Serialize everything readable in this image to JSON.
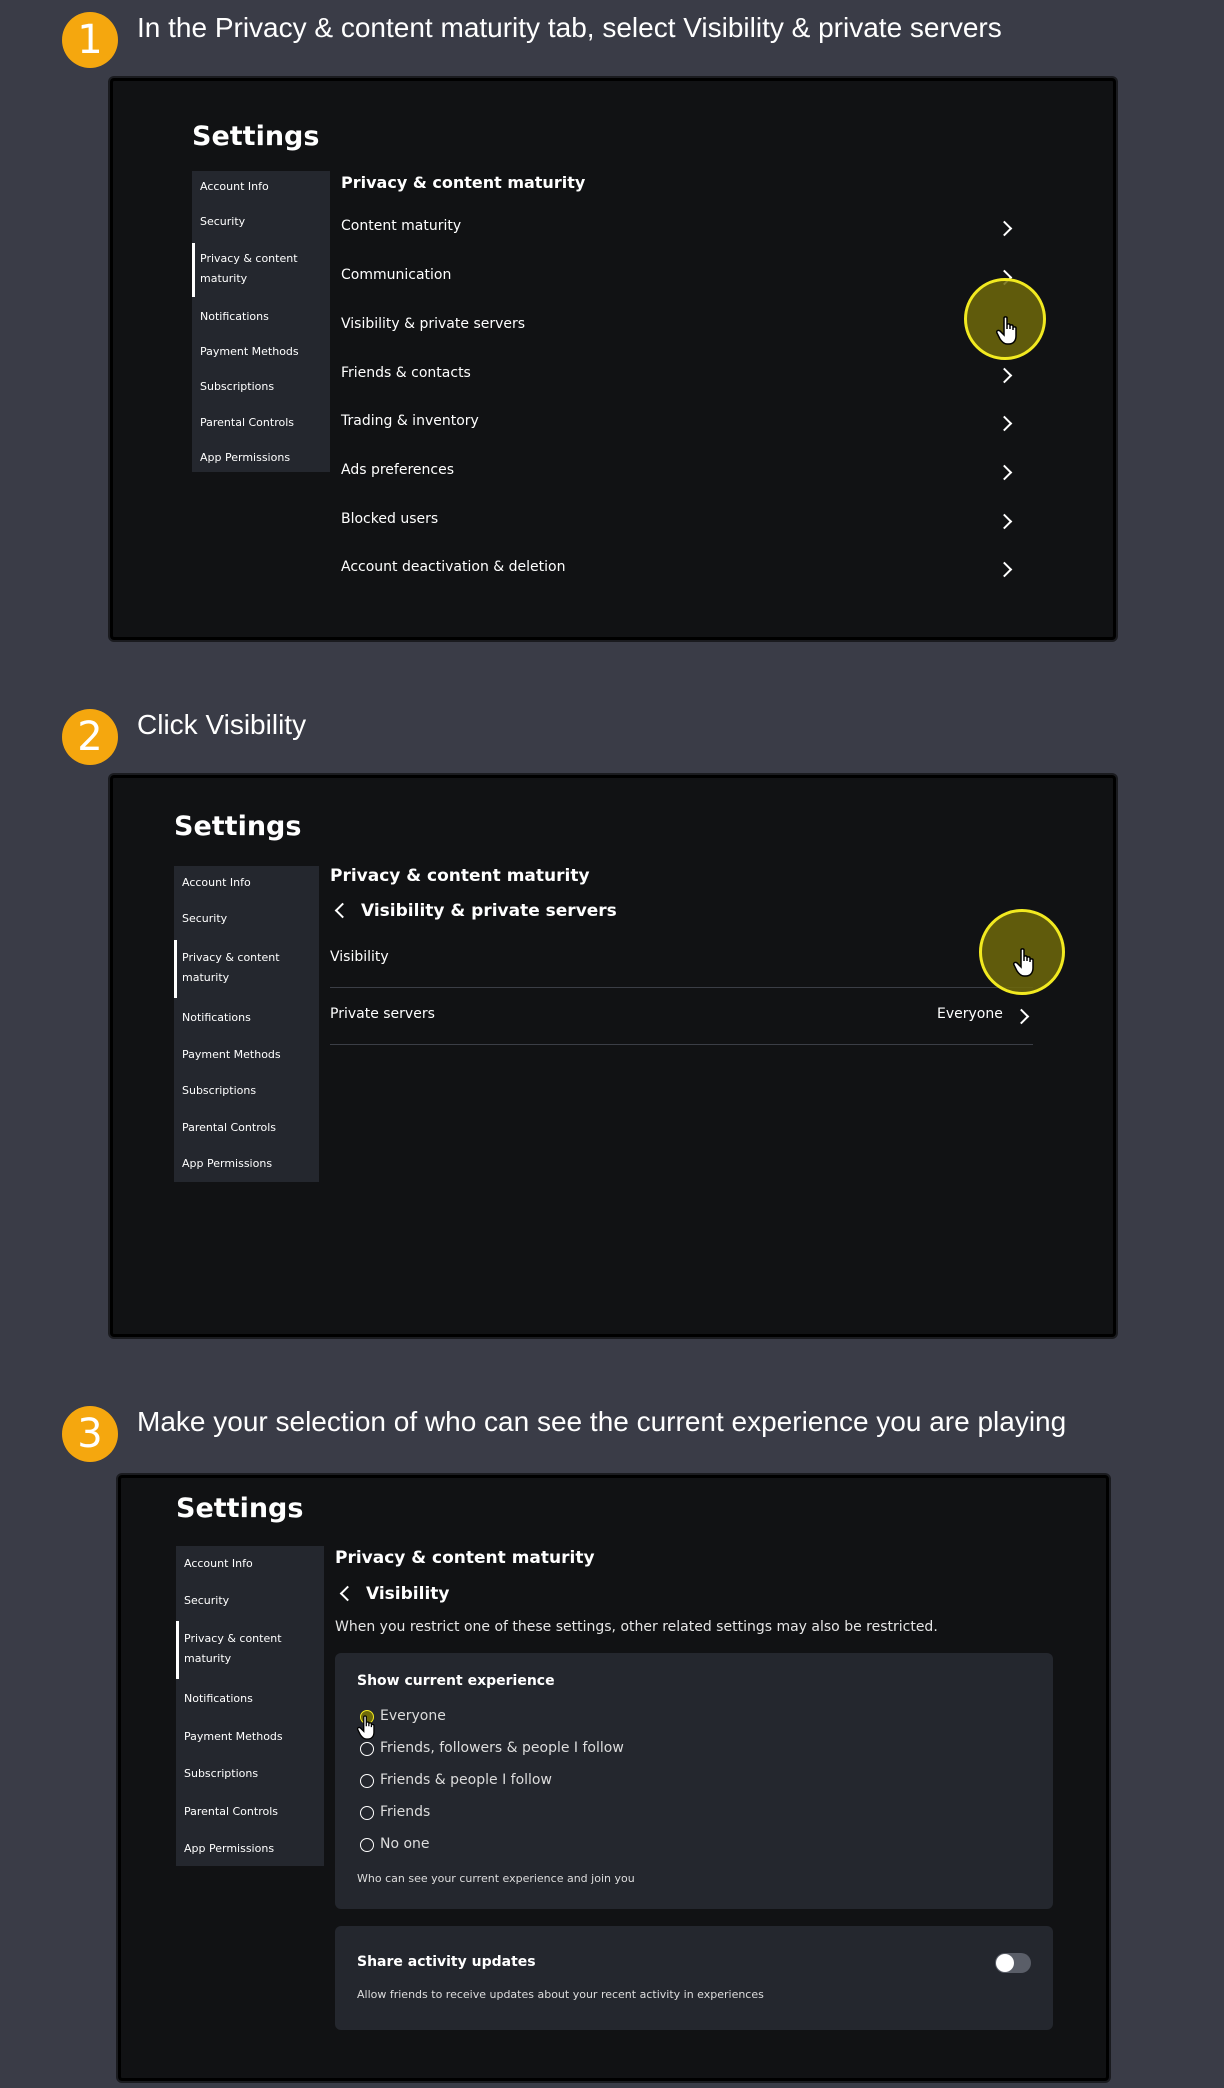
{
  "steps": [
    {
      "number": "1",
      "text": "In the Privacy & content maturity tab, select Visibility & private servers"
    },
    {
      "number": "2",
      "text": "Click Visibility"
    },
    {
      "number": "3",
      "text": "Make your selection of who can see the current experience you are playing"
    }
  ],
  "settings_title": "Settings",
  "sidebar": {
    "items": [
      "Account Info",
      "Security",
      "Privacy & content",
      "maturity",
      "Notifications",
      "Payment Methods",
      "Subscriptions",
      "Parental Controls",
      "App Permissions"
    ]
  },
  "privacy_title": "Privacy & content maturity",
  "panel1": {
    "rows": [
      "Content maturity",
      "Communication",
      "Visibility & private servers",
      "Friends & contacts",
      "Trading & inventory",
      "Ads preferences",
      "Blocked users",
      "Account deactivation & deletion"
    ]
  },
  "panel2": {
    "subtitle": "Visibility & private servers",
    "rows": [
      {
        "label": "Visibility",
        "value": ""
      },
      {
        "label": "Private servers",
        "value": "Everyone"
      }
    ]
  },
  "panel3": {
    "subtitle": "Visibility",
    "notice": "When you restrict one of these settings, other related settings may also be restricted.",
    "experience_card": {
      "title": "Show current experience",
      "options": [
        "Everyone",
        "Friends, followers & people I follow",
        "Friends & people I follow",
        "Friends",
        "No one"
      ],
      "selected": "Everyone",
      "hint": "Who can see your current experience and join you"
    },
    "activity_card": {
      "title": "Share activity updates",
      "hint": "Allow friends to receive updates about your recent activity in experiences",
      "toggle_on": false
    }
  },
  "colors": {
    "badge": "#f5a70e",
    "highlight_ring": "#f2ea20",
    "background": "#3a3c47"
  }
}
